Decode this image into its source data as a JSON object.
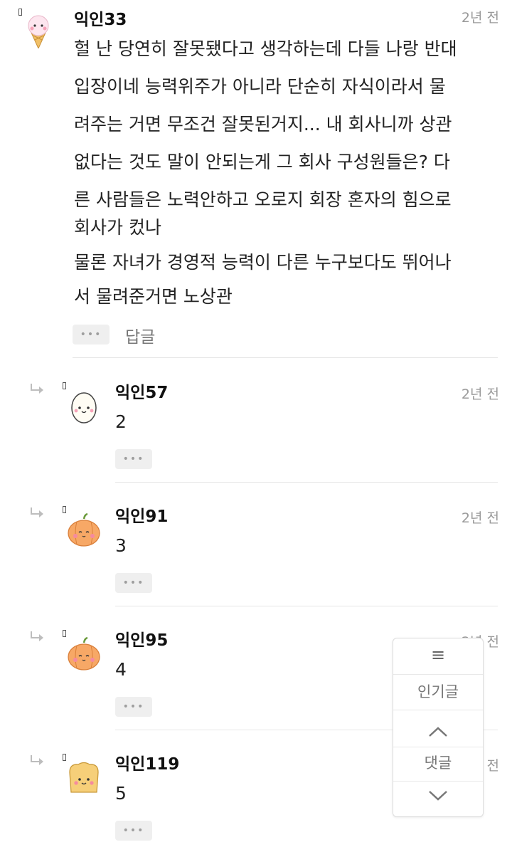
{
  "main_comment": {
    "author": "익인33",
    "time": "2년 전",
    "lines": [
      "헐 난 당연히 잘못됐다고 생각하는데 다들 나랑 반대",
      "입장이네 능력위주가 아니라 단순히 자식이라서 물",
      "려주는 거면 무조건 잘못된거지... 내 회사니까 상관",
      "없다는 것도 말이 안되는게 그 회사 구성원들은? 다",
      "른 사람들은 노력안하고 오로지 회장 혼자의 힘으로",
      "회사가 컸나",
      "물론 자녀가 경영적 능력이 다른 누구보다도 뛰어나",
      "서 물려준거면 노상관"
    ],
    "more_label": "•••",
    "reply_label": "답글"
  },
  "replies": [
    {
      "author": "익인57",
      "time": "2년 전",
      "text": "2",
      "avatar": "egg-avatar",
      "more_label": "•••"
    },
    {
      "author": "익인91",
      "time": "2년 전",
      "text": "3",
      "avatar": "pumpkin-avatar",
      "more_label": "•••"
    },
    {
      "author": "익인95",
      "time": "2년 전",
      "text": "4",
      "avatar": "pumpkin-avatar",
      "more_label": "•••"
    },
    {
      "author": "익인119",
      "time": "2년 전",
      "text": "5",
      "avatar": "toast-avatar",
      "more_label": "•••"
    }
  ],
  "floating_panel": {
    "menu_icon": "≡",
    "popular_label": "인기글",
    "comments_label": "댓글",
    "up_icon": "chevron-up-icon",
    "down_icon": "chevron-down-icon"
  }
}
